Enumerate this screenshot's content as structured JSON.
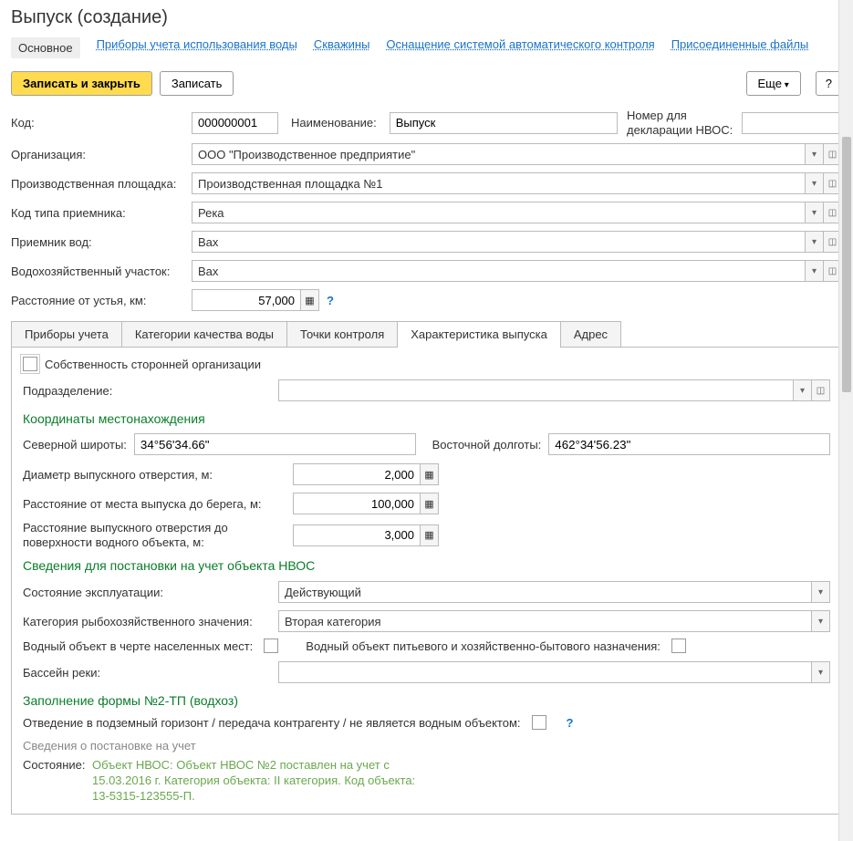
{
  "title": "Выпуск (создание)",
  "nav": {
    "items": [
      "Основное",
      "Приборы учета использования воды",
      "Скважины",
      "Оснащение системой автоматического контроля",
      "Присоединенные файлы"
    ],
    "active": 0
  },
  "toolbar": {
    "save_close": "Записать и закрыть",
    "save": "Записать",
    "more": "Еще",
    "help": "?"
  },
  "header": {
    "code_label": "Код:",
    "code_value": "000000001",
    "name_label": "Наименование:",
    "name_value": "Выпуск",
    "decl_label": "Номер для декларации НВОС:",
    "decl_value": ""
  },
  "fields": {
    "org_label": "Организация:",
    "org_value": "ООО \"Производственное предприятие\"",
    "site_label": "Производственная площадка:",
    "site_value": "Производственная площадка №1",
    "recv_type_label": "Код типа приемника:",
    "recv_type_value": "Река",
    "recv_label": "Приемник вод:",
    "recv_value": "Вах",
    "wh_area_label": "Водохозяйственный участок:",
    "wh_area_value": "Вах",
    "dist_label": "Расстояние от устья, км:",
    "dist_value": "57,000"
  },
  "tabs": {
    "items": [
      "Приборы учета",
      "Категории качества воды",
      "Точки контроля",
      "Характеристика выпуска",
      "Адрес"
    ],
    "active": 3
  },
  "char": {
    "own_label": "Собственность сторонней организации",
    "dept_label": "Подразделение:",
    "dept_value": "",
    "coord_title": "Координаты местонахождения",
    "lat_label": "Северной широты:",
    "lat_value": "34°56'34.66\"",
    "lon_label": "Восточной долготы:",
    "lon_value": "462°34'56.23\"",
    "diam_label": "Диаметр выпускного отверстия, м:",
    "diam_value": "2,000",
    "shore_label": "Расстояние от места выпуска до берега, м:",
    "shore_value": "100,000",
    "surf_label": "Расстояние выпускного отверстия до поверхности водного объекта, м:",
    "surf_value": "3,000",
    "nvos_title": "Сведения для постановки на учет объекта НВОС",
    "state_label": "Состояние эксплуатации:",
    "state_value": "Действующий",
    "fish_label": "Категория рыбохозяйственного значения:",
    "fish_value": "Вторая категория",
    "urban_label": "Водный объект в черте населенных мест:",
    "drink_label": "Водный объект питьевого и хозяйственно-бытового назначения:",
    "basin_label": "Бассейн реки:",
    "basin_value": "",
    "form_title": "Заполнение формы №2-ТП (водхоз)",
    "discharge_label": "Отведение в подземный горизонт / передача контрагенту / не является водным объектом:",
    "reg_title": "Сведения о постановке на учет",
    "status_label": "Состояние:",
    "status_text": "Объект НВОС: Объект НВОС №2 поставлен на учет с 15.03.2016 г. Категория объекта: II категория. Код объекта: 13-5315-123555-П."
  }
}
